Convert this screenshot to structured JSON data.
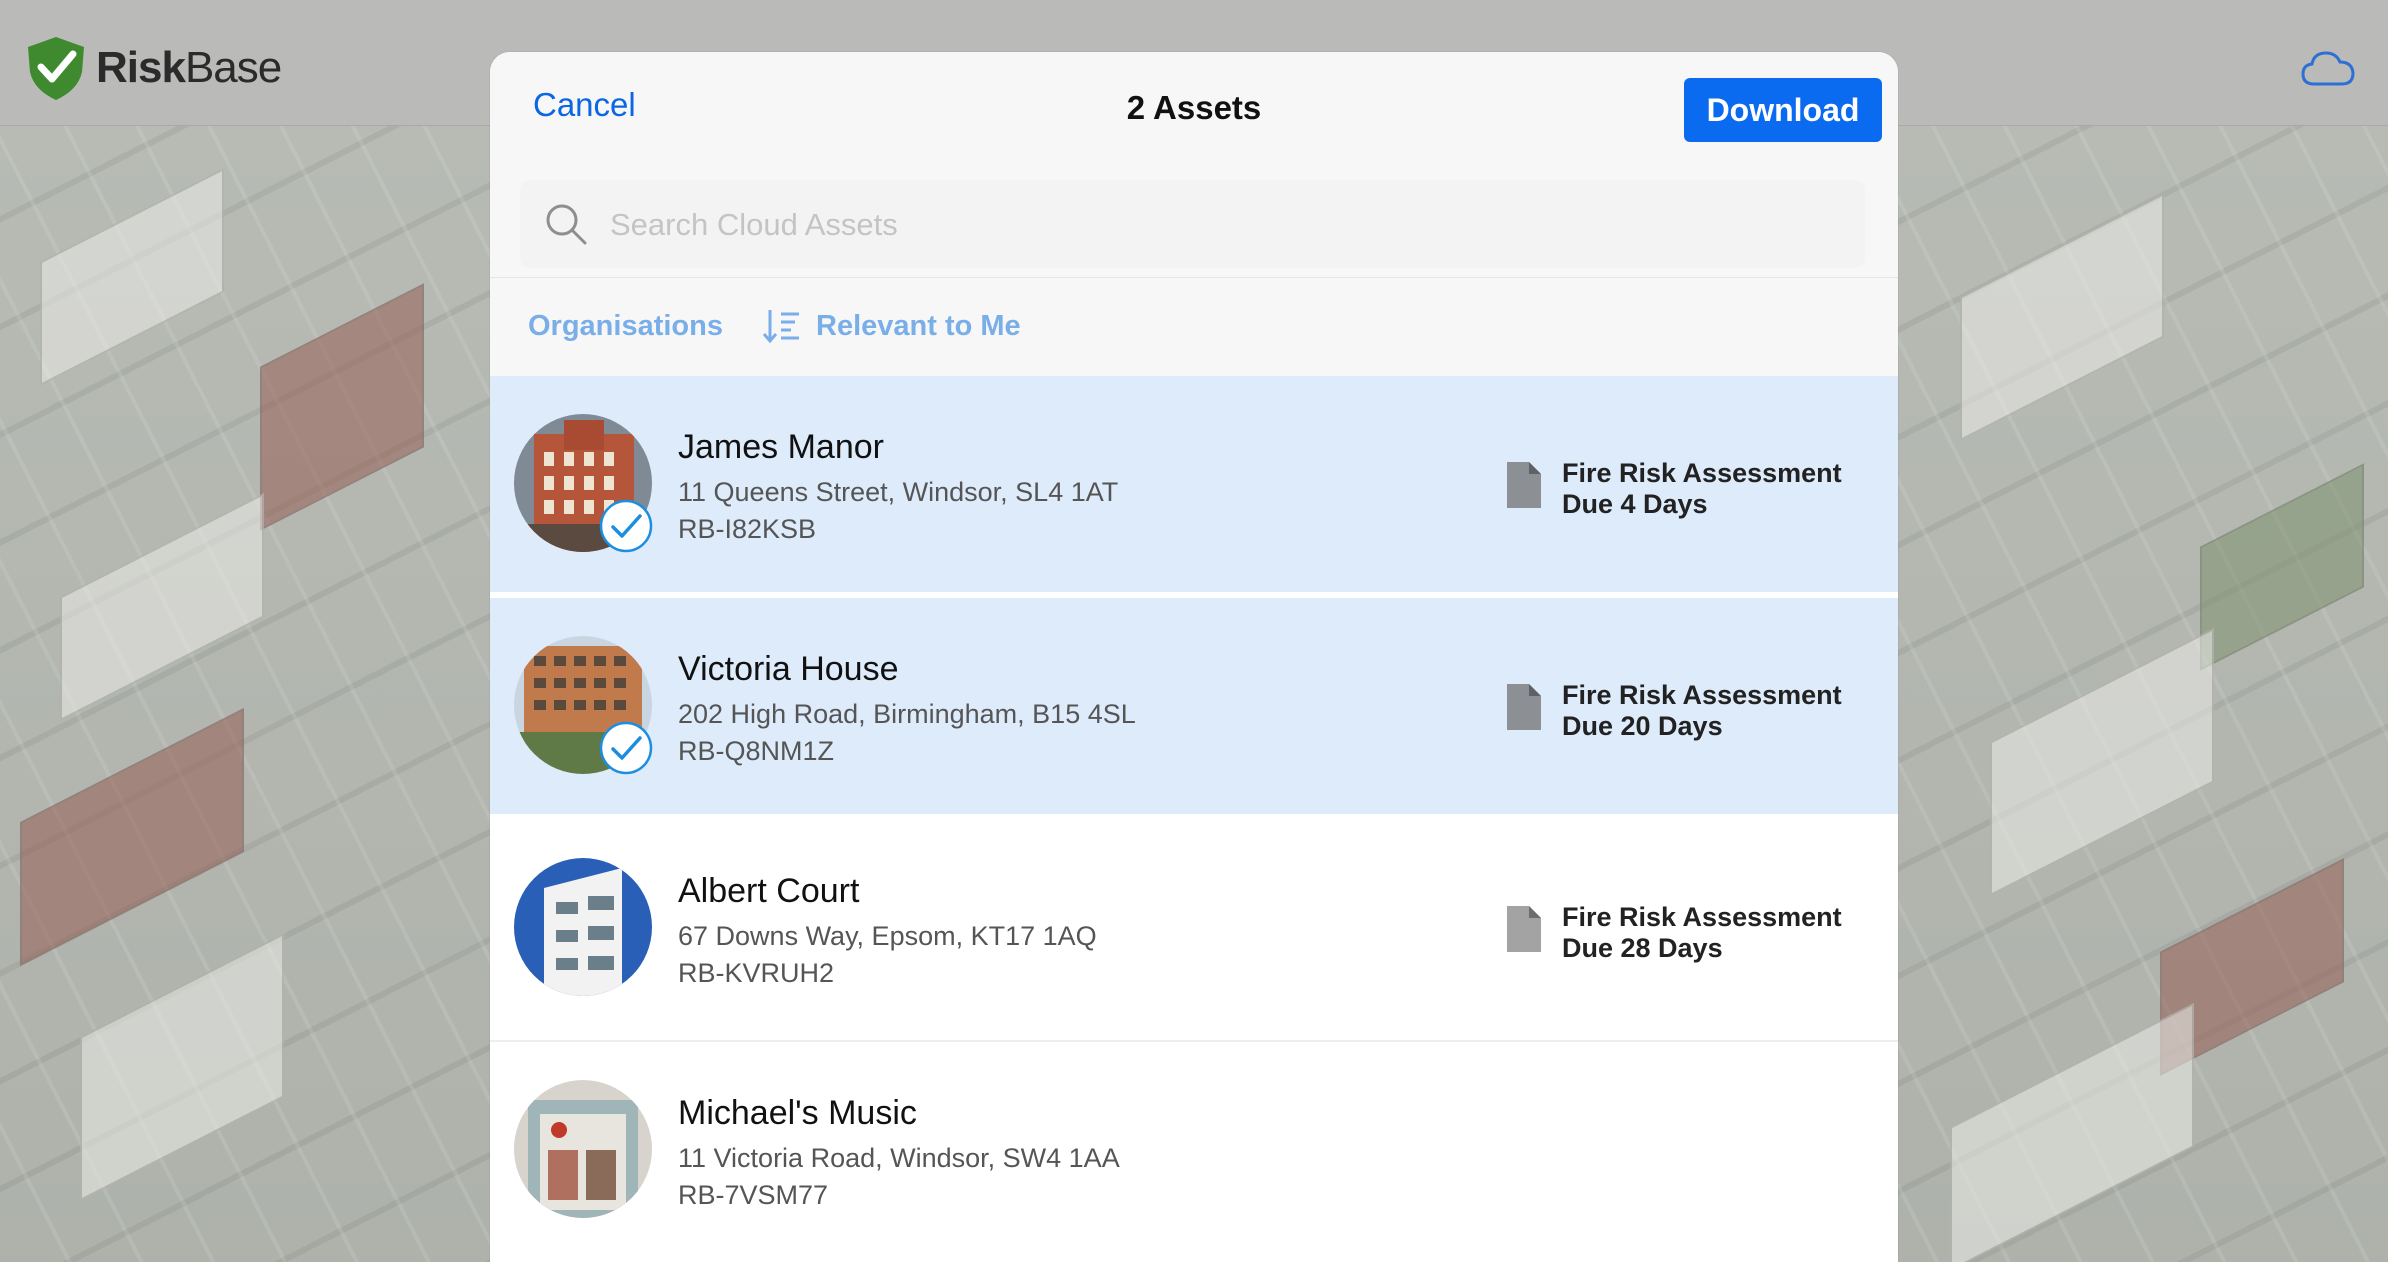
{
  "app": {
    "brand_risk": "Risk",
    "brand_base": "Base"
  },
  "modal": {
    "cancel_label": "Cancel",
    "title": "2 Assets",
    "download_label": "Download",
    "search": {
      "placeholder": "Search Cloud Assets",
      "value": ""
    },
    "filters": {
      "organisations_label": "Organisations",
      "sort_label": "Relevant to Me"
    }
  },
  "assets": [
    {
      "name": "James Manor",
      "address": "11 Queens Street, Windsor, SL4 1AT",
      "ref": "RB-I82KSB",
      "selected": true,
      "assessment": {
        "type": "Fire Risk Assessment",
        "due": "Due 4 Days"
      }
    },
    {
      "name": "Victoria House",
      "address": "202 High Road, Birmingham, B15 4SL",
      "ref": "RB-Q8NM1Z",
      "selected": true,
      "assessment": {
        "type": "Fire Risk Assessment",
        "due": "Due 20 Days"
      }
    },
    {
      "name": "Albert Court",
      "address": "67 Downs Way, Epsom, KT17 1AQ",
      "ref": "RB-KVRUH2",
      "selected": false,
      "assessment": {
        "type": "Fire Risk Assessment",
        "due": "Due 28 Days"
      }
    },
    {
      "name": "Michael's Music",
      "address": "11 Victoria Road, Windsor, SW4 1AA",
      "ref": "RB-7VSM77",
      "selected": false
    }
  ],
  "colors": {
    "accent": "#0a6bf0",
    "selected_row": "#deebfb",
    "filter_text": "#7aaee8",
    "logo_green": "#3f8a2e"
  },
  "icons": {
    "logo": "shield-check-icon",
    "cloud": "cloud-icon",
    "search": "search-icon",
    "sort": "sort-descending-icon",
    "document": "document-icon",
    "check": "checkmark-circle-icon"
  }
}
